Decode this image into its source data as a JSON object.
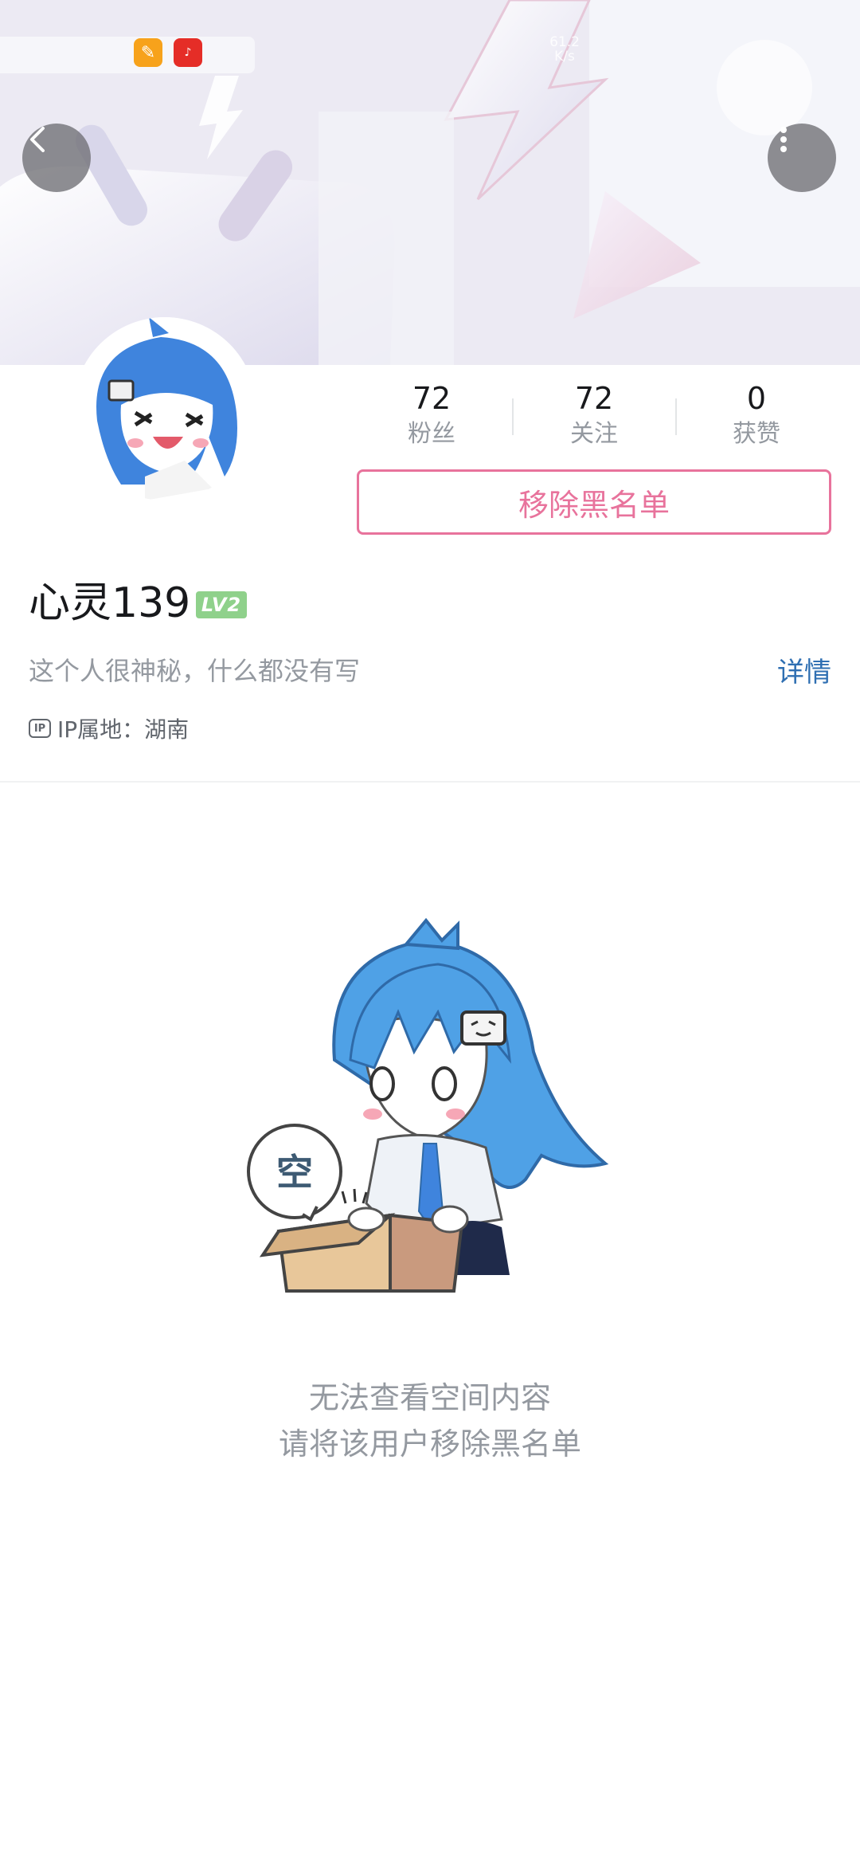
{
  "status_bar": {
    "network_speed": "61.2\nK/s"
  },
  "header": {
    "back_icon": "chevron-left-icon",
    "more_icon": "vertical-dots-icon"
  },
  "profile": {
    "avatar": "anime-avatar",
    "stats": [
      {
        "value": "72",
        "label": "粉丝"
      },
      {
        "value": "72",
        "label": "关注"
      },
      {
        "value": "0",
        "label": "获赞"
      }
    ],
    "unblock_label": "移除黑名单",
    "username": "心灵139",
    "level_badge": "LV2",
    "bio": "这个人很神秘，什么都没有写",
    "detail_label": "详情",
    "ip_icon_label": "IP",
    "ip_location": "IP属地：湖南"
  },
  "empty_state": {
    "bubble_text": "空",
    "line1": "无法查看空间内容",
    "line2": "请将该用户移除黑名单"
  },
  "colors": {
    "accent_pink": "#e8739c",
    "link_blue": "#2f6fb2",
    "level_green": "#8fd18b"
  }
}
